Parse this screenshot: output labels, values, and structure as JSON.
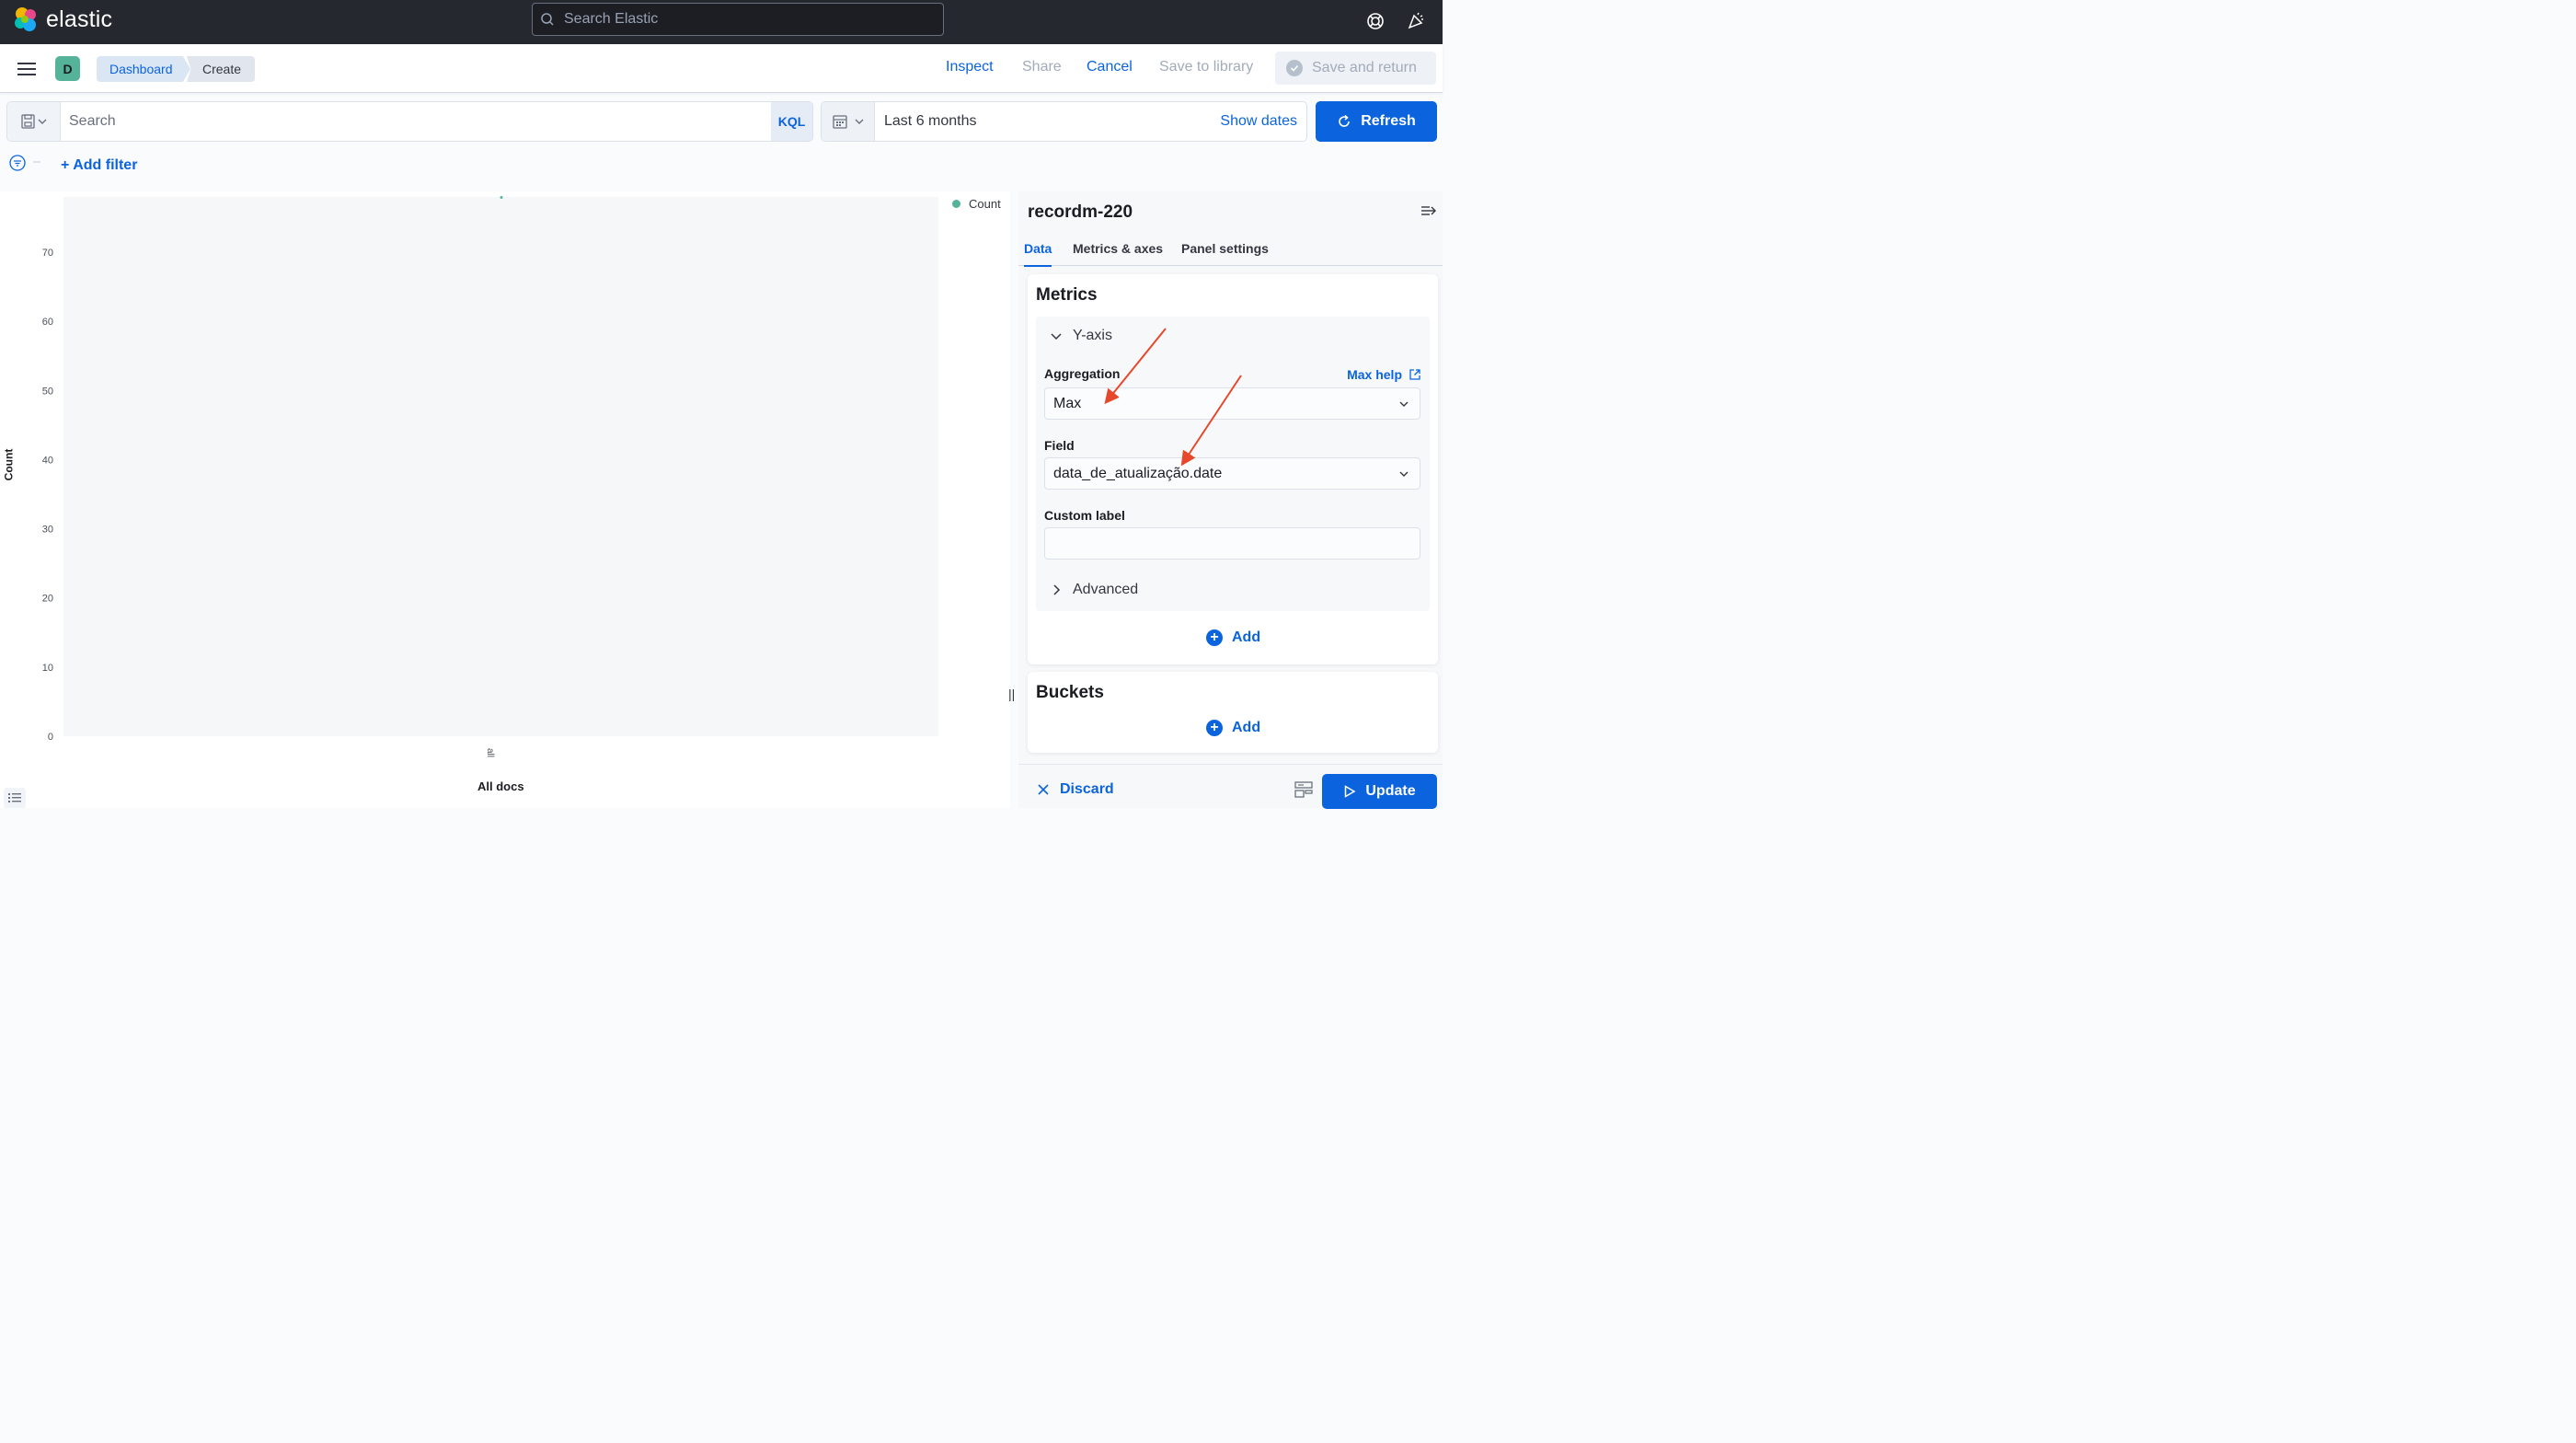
{
  "header": {
    "logo_text": "elastic",
    "search_placeholder": "Search Elastic",
    "icons": [
      "elastic-logo-icon",
      "search-icon",
      "help-icon",
      "news-icon"
    ]
  },
  "appbar": {
    "space_initial": "D",
    "breadcrumbs": [
      "Dashboard",
      "Create"
    ],
    "inspect": "Inspect",
    "share": "Share",
    "cancel": "Cancel",
    "save_to_library": "Save to library",
    "save_and_return": "Save and return"
  },
  "querybar": {
    "search_placeholder": "Search",
    "language": "KQL",
    "time_range": "Last 6 months",
    "show_dates": "Show dates",
    "refresh": "Refresh",
    "add_filter": "+ Add filter"
  },
  "chart_data": {
    "type": "bar",
    "categories": [
      "all"
    ],
    "series": [
      {
        "name": "Count",
        "values": [
          78
        ]
      }
    ],
    "xlabel": "All docs",
    "ylabel": "Count",
    "yticks": [
      0,
      10,
      20,
      30,
      40,
      50,
      60,
      70
    ],
    "ylim": [
      0,
      78
    ],
    "legend": "top-right",
    "legend_entries": [
      "Count"
    ],
    "series_color": "#54b399",
    "grid": false
  },
  "sidebar": {
    "title": "recordm-220",
    "tabs": [
      "Data",
      "Metrics & axes",
      "Panel settings"
    ],
    "active_tab": "Data",
    "metrics": {
      "title": "Metrics",
      "group_label": "Y-axis",
      "aggregation_label": "Aggregation",
      "aggregation_help": "Max help",
      "aggregation_value": "Max",
      "field_label": "Field",
      "field_value": "data_de_atualização.date",
      "custom_label_label": "Custom label",
      "custom_label_value": "",
      "advanced": "Advanced",
      "add": "Add"
    },
    "buckets": {
      "title": "Buckets",
      "add": "Add"
    },
    "footer": {
      "discard": "Discard",
      "update": "Update"
    }
  },
  "colors": {
    "header_bg": "#25282f",
    "primary": "#0b64dd",
    "series": "#54b399",
    "annotation_arrow": "#e7472b"
  }
}
